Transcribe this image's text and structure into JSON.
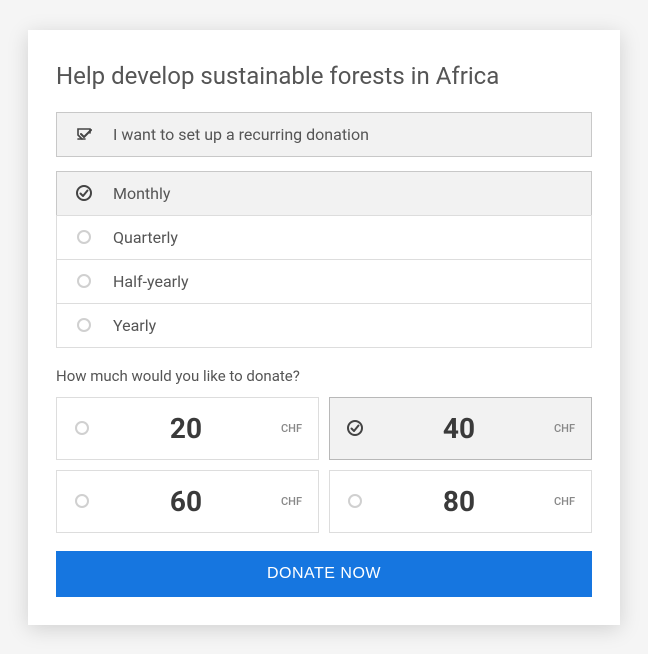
{
  "title": "Help develop sustainable forests in Africa",
  "recurring": {
    "label": "I want to set up a recurring donation",
    "checked": true
  },
  "frequency": {
    "options": [
      {
        "label": "Monthly",
        "selected": true
      },
      {
        "label": "Quarterly",
        "selected": false
      },
      {
        "label": "Half-yearly",
        "selected": false
      },
      {
        "label": "Yearly",
        "selected": false
      }
    ]
  },
  "amount": {
    "question": "How much would you like to donate?",
    "currency": "CHF",
    "options": [
      {
        "value": "20",
        "selected": false
      },
      {
        "value": "40",
        "selected": true
      },
      {
        "value": "60",
        "selected": false
      },
      {
        "value": "80",
        "selected": false
      }
    ]
  },
  "cta": {
    "label": "DONATE NOW"
  },
  "colors": {
    "primary": "#1676e0"
  }
}
